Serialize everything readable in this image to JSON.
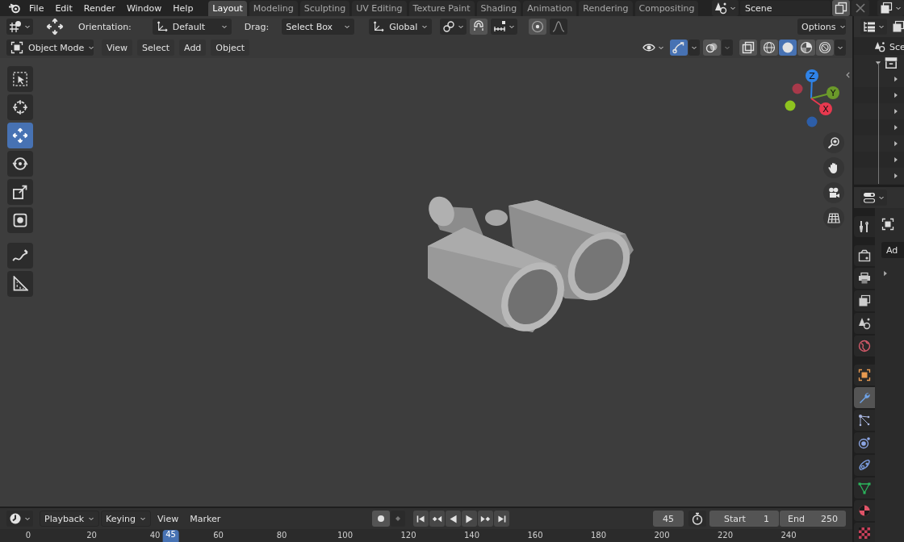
{
  "topbar": {
    "menus": [
      "File",
      "Edit",
      "Render",
      "Window",
      "Help"
    ],
    "workspaces": [
      {
        "label": "Layout",
        "selected": true
      },
      {
        "label": "Modeling",
        "selected": false
      },
      {
        "label": "Sculpting",
        "selected": false
      },
      {
        "label": "UV Editing",
        "selected": false
      },
      {
        "label": "Texture Paint",
        "selected": false
      },
      {
        "label": "Shading",
        "selected": false
      },
      {
        "label": "Animation",
        "selected": false
      },
      {
        "label": "Rendering",
        "selected": false
      },
      {
        "label": "Compositing",
        "selected": false
      }
    ],
    "scene": "Scene"
  },
  "tool_settings": {
    "orientation_label": "Orientation:",
    "orientation": "Default",
    "drag_label": "Drag:",
    "drag": "Select Box",
    "transform_orientation": "Global",
    "options": "Options"
  },
  "viewport_header": {
    "mode": "Object Mode",
    "menus": [
      "View",
      "Select",
      "Add",
      "Object"
    ],
    "gizmos_on": true,
    "shading": [
      {
        "kind": "wireframe",
        "selected": false
      },
      {
        "kind": "solid",
        "selected": true
      },
      {
        "kind": "material",
        "selected": false
      },
      {
        "kind": "rendered",
        "selected": false
      }
    ]
  },
  "toolbar": [
    {
      "kind": "select_box",
      "selected": false
    },
    {
      "kind": "cursor",
      "selected": false
    },
    {
      "kind": "move",
      "selected": true
    },
    {
      "kind": "rotate",
      "selected": false
    },
    {
      "kind": "scale",
      "selected": false
    },
    {
      "kind": "transform",
      "selected": false
    },
    {
      "kind": "annotate",
      "selected": false
    },
    {
      "kind": "measure",
      "selected": false
    }
  ],
  "gizmo": {
    "axes": [
      {
        "label": "Z",
        "color": "#2f83e8"
      },
      {
        "label": "Y",
        "color": "#6b9a2a"
      },
      {
        "label": "X",
        "color": "#e8394f"
      }
    ]
  },
  "outliner": {
    "root": "Sce"
  },
  "properties": {
    "add_label": "Ad",
    "tabs": [
      {
        "kind": "tool",
        "selected": false
      },
      {
        "kind": "render",
        "selected": false
      },
      {
        "kind": "output",
        "selected": false
      },
      {
        "kind": "view_layer",
        "selected": false
      },
      {
        "kind": "scene",
        "selected": false
      },
      {
        "kind": "world",
        "selected": false
      },
      {
        "kind": "object",
        "selected": false
      },
      {
        "kind": "modifier",
        "selected": true
      },
      {
        "kind": "particles",
        "selected": false
      },
      {
        "kind": "physics",
        "selected": false
      },
      {
        "kind": "constraints",
        "selected": false
      },
      {
        "kind": "data",
        "selected": false
      },
      {
        "kind": "material",
        "selected": false
      },
      {
        "kind": "texture",
        "selected": false
      }
    ]
  },
  "timeline": {
    "menus": [
      {
        "label": "Playback",
        "kind": "dropdown"
      },
      {
        "label": "Keying",
        "kind": "dropdown"
      },
      {
        "label": "View",
        "kind": "menu"
      },
      {
        "label": "Marker",
        "kind": "menu"
      }
    ],
    "current_frame": "45",
    "start_label": "Start",
    "start": "1",
    "end_label": "End",
    "end": "250",
    "ruler": [
      "0",
      "20",
      "40",
      "60",
      "80",
      "100",
      "120",
      "140",
      "160",
      "180",
      "200",
      "220",
      "240"
    ],
    "playhead": "45"
  }
}
